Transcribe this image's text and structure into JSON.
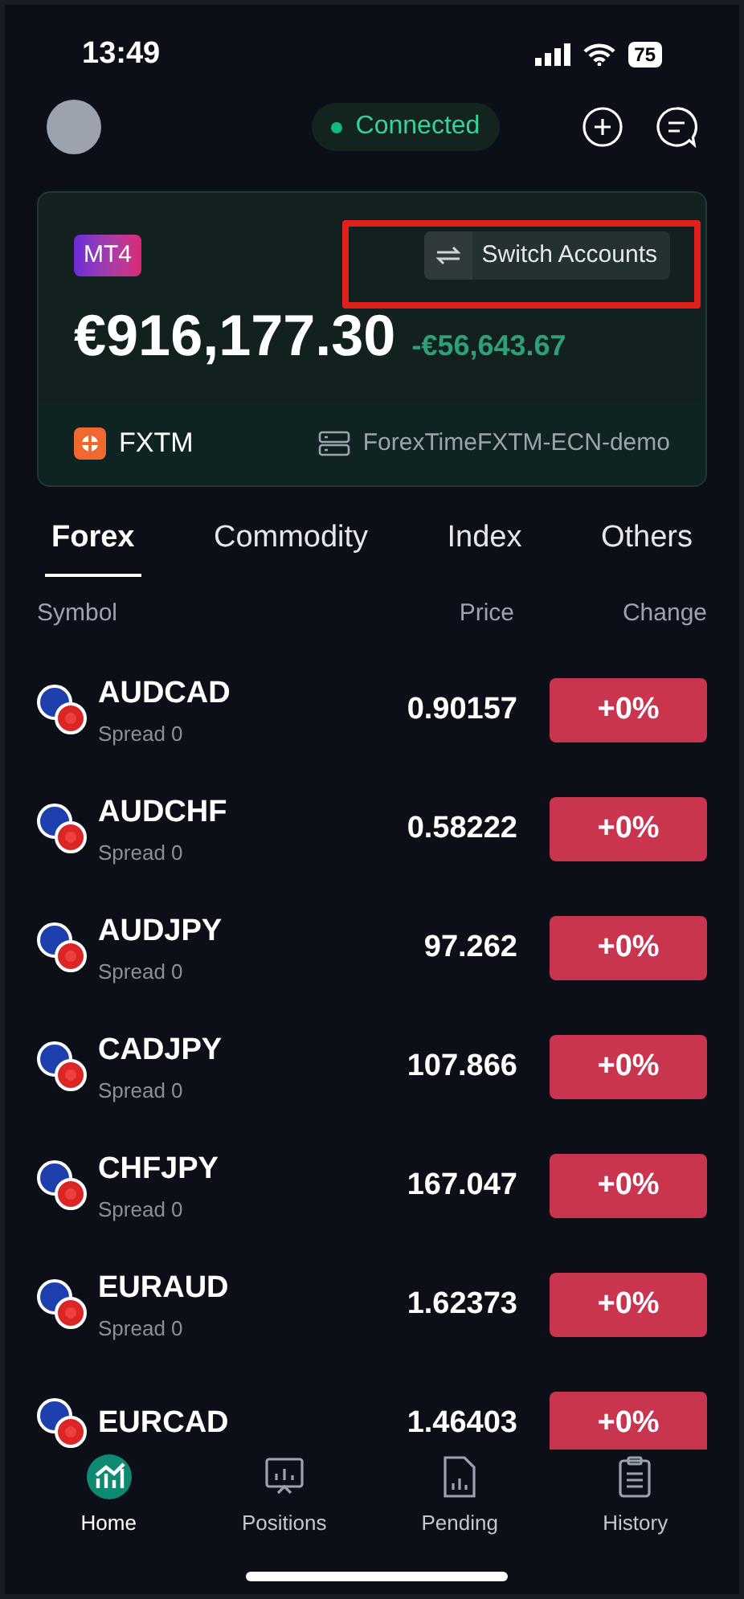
{
  "status_bar": {
    "time": "13:49",
    "battery": "75"
  },
  "header": {
    "connection": "Connected",
    "connected": true
  },
  "account": {
    "platform": "MT4",
    "switch_label": "Switch Accounts",
    "balance": "€916,177.30",
    "pnl": "-€56,643.67",
    "broker": "FXTM",
    "server": "ForexTimeFXTM-ECN-demo"
  },
  "tabs": [
    {
      "label": "Forex",
      "selected": true
    },
    {
      "label": "Commodity",
      "selected": false
    },
    {
      "label": "Index",
      "selected": false
    },
    {
      "label": "Others",
      "selected": false
    }
  ],
  "table": {
    "columns": [
      "Symbol",
      "Price",
      "Change"
    ],
    "rows": [
      {
        "symbol": "AUDCAD",
        "spread": "Spread 0",
        "price": "0.90157",
        "change": "+0%"
      },
      {
        "symbol": "AUDCHF",
        "spread": "Spread 0",
        "price": "0.58222",
        "change": "+0%"
      },
      {
        "symbol": "AUDJPY",
        "spread": "Spread 0",
        "price": "97.262",
        "change": "+0%"
      },
      {
        "symbol": "CADJPY",
        "spread": "Spread 0",
        "price": "107.866",
        "change": "+0%"
      },
      {
        "symbol": "CHFJPY",
        "spread": "Spread 0",
        "price": "167.047",
        "change": "+0%"
      },
      {
        "symbol": "EURAUD",
        "spread": "Spread 0",
        "price": "1.62373",
        "change": "+0%"
      },
      {
        "symbol": "EURCAD",
        "price": "1.46403",
        "change": "+0%"
      }
    ]
  },
  "nav": [
    {
      "label": "Home",
      "selected": true
    },
    {
      "label": "Positions",
      "selected": false
    },
    {
      "label": "Pending",
      "selected": false
    },
    {
      "label": "History",
      "selected": false
    }
  ]
}
